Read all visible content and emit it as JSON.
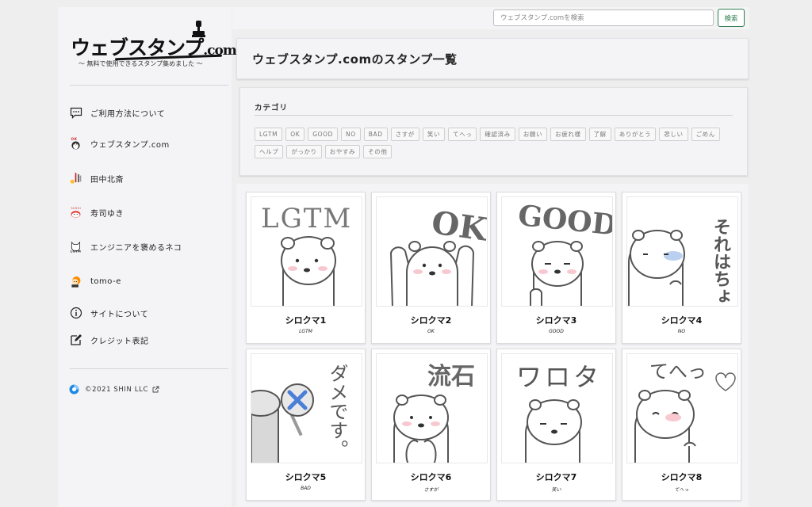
{
  "logo": {
    "title": "ウェブスタンプ",
    "title_suffix": ".com",
    "subtitle": "〜 無料で使用できるスタンプ集めました 〜"
  },
  "sidebar": {
    "items": [
      {
        "label": "ご利用方法について",
        "icon": "chat-icon"
      },
      {
        "label": "ウェブスタンプ.com",
        "icon": "penguin-icon"
      },
      {
        "label": "田中北斎",
        "icon": "tanaka-hokusai-icon"
      },
      {
        "label": "寿司ゆき",
        "icon": "sushi-icon"
      },
      {
        "label": "エンジニアを褒めるネコ",
        "icon": "cat-icon"
      },
      {
        "label": "tomo-e",
        "icon": "tomo-e-icon"
      },
      {
        "label": "サイトについて",
        "icon": "info-icon"
      },
      {
        "label": "クレジット表記",
        "icon": "edit-icon"
      }
    ],
    "copyright": "©2021 SHIN LLC"
  },
  "search": {
    "placeholder": "ウェブスタンプ.comを検索",
    "button_label": "検索"
  },
  "page": {
    "title": "ウェブスタンプ.comのスタンプ一覧"
  },
  "categories": {
    "heading": "カテゴリ",
    "tags": [
      "LGTM",
      "OK",
      "GOOD",
      "NO",
      "BAD",
      "さすが",
      "笑い",
      "てへっ",
      "確認済み",
      "お願い",
      "お疲れ様",
      "了解",
      "ありがとう",
      "悲しい",
      "ごめん",
      "ヘルプ",
      "がっかり",
      "おやすみ",
      "その他"
    ]
  },
  "stamps": [
    {
      "name": "シロクマ1",
      "tag": "LGTM",
      "caption": "LGTM"
    },
    {
      "name": "シロクマ2",
      "tag": "OK",
      "caption": "OK"
    },
    {
      "name": "シロクマ3",
      "tag": "GOOD",
      "caption": "GOOD"
    },
    {
      "name": "シロクマ4",
      "tag": "NO",
      "caption": "それはちょっと…"
    },
    {
      "name": "シロクマ5",
      "tag": "BAD",
      "caption": "ダメです。"
    },
    {
      "name": "シロクマ6",
      "tag": "さすが",
      "caption": "流石"
    },
    {
      "name": "シロクマ7",
      "tag": "笑い",
      "caption": "ワロタ"
    },
    {
      "name": "シロクマ8",
      "tag": "てへっ",
      "caption": "てへっ"
    }
  ],
  "colors": {
    "accent": "#2e7d4f",
    "background": "#eeeeee",
    "panel": "#f4f4f6"
  }
}
